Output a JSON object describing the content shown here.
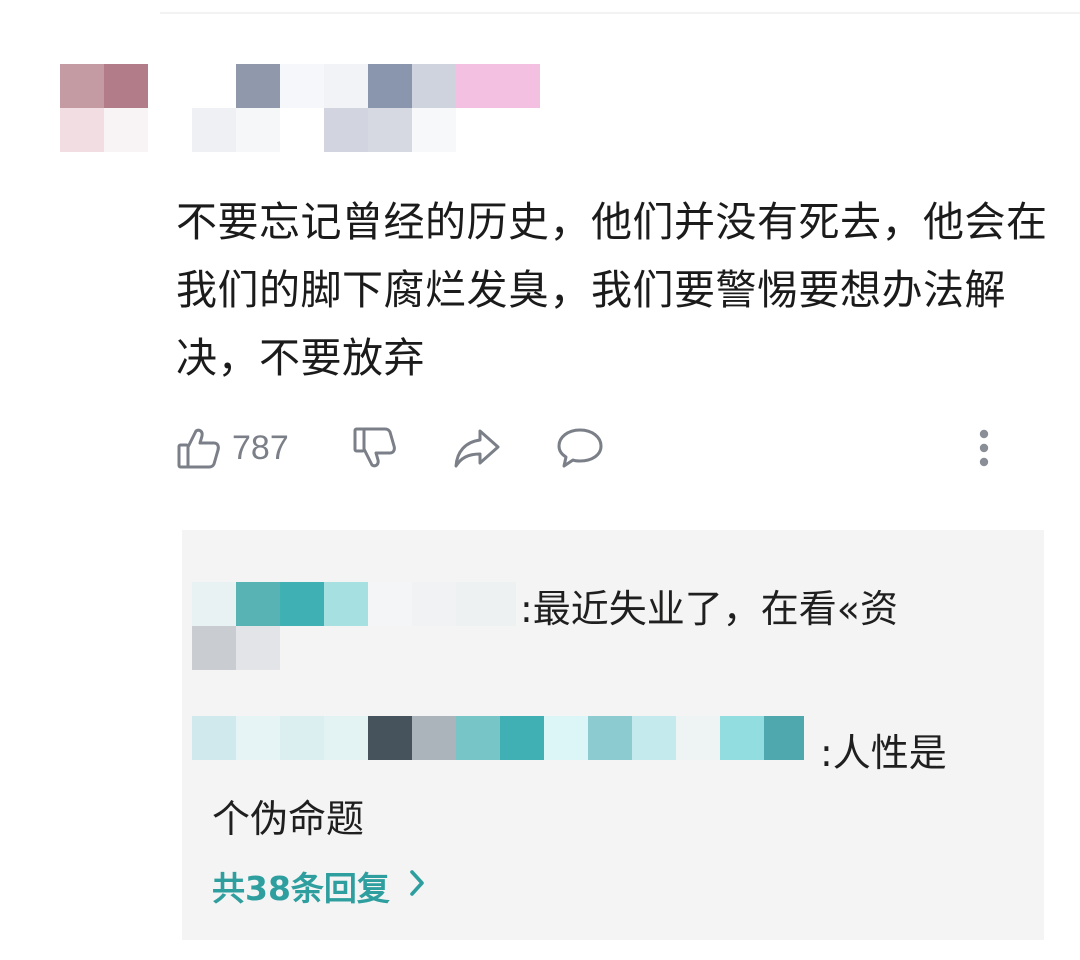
{
  "comment": {
    "text": "不要忘记曾经的历史，他们并没有死去，他会在我们的脚下腐烂发臭，我们要警惕要想办法解决，不要放弃",
    "like_count": "787"
  },
  "actions": {
    "like_icon": "thumbs-up-icon",
    "dislike_icon": "thumbs-down-icon",
    "share_icon": "share-icon",
    "comment_icon": "comment-icon",
    "more_icon": "more-vertical-icon"
  },
  "replies": {
    "items": [
      {
        "text": ":最近失业了，在看«资"
      },
      {
        "text_line1": ":人性是",
        "text_line2": "个伪命题"
      }
    ],
    "more_label": "共38条回复",
    "more_icon": "chevron-right-icon"
  },
  "colors": {
    "accent": "#2e9f9e",
    "icon_gray": "#7b7f88",
    "reply_bg": "#f4f4f5"
  }
}
